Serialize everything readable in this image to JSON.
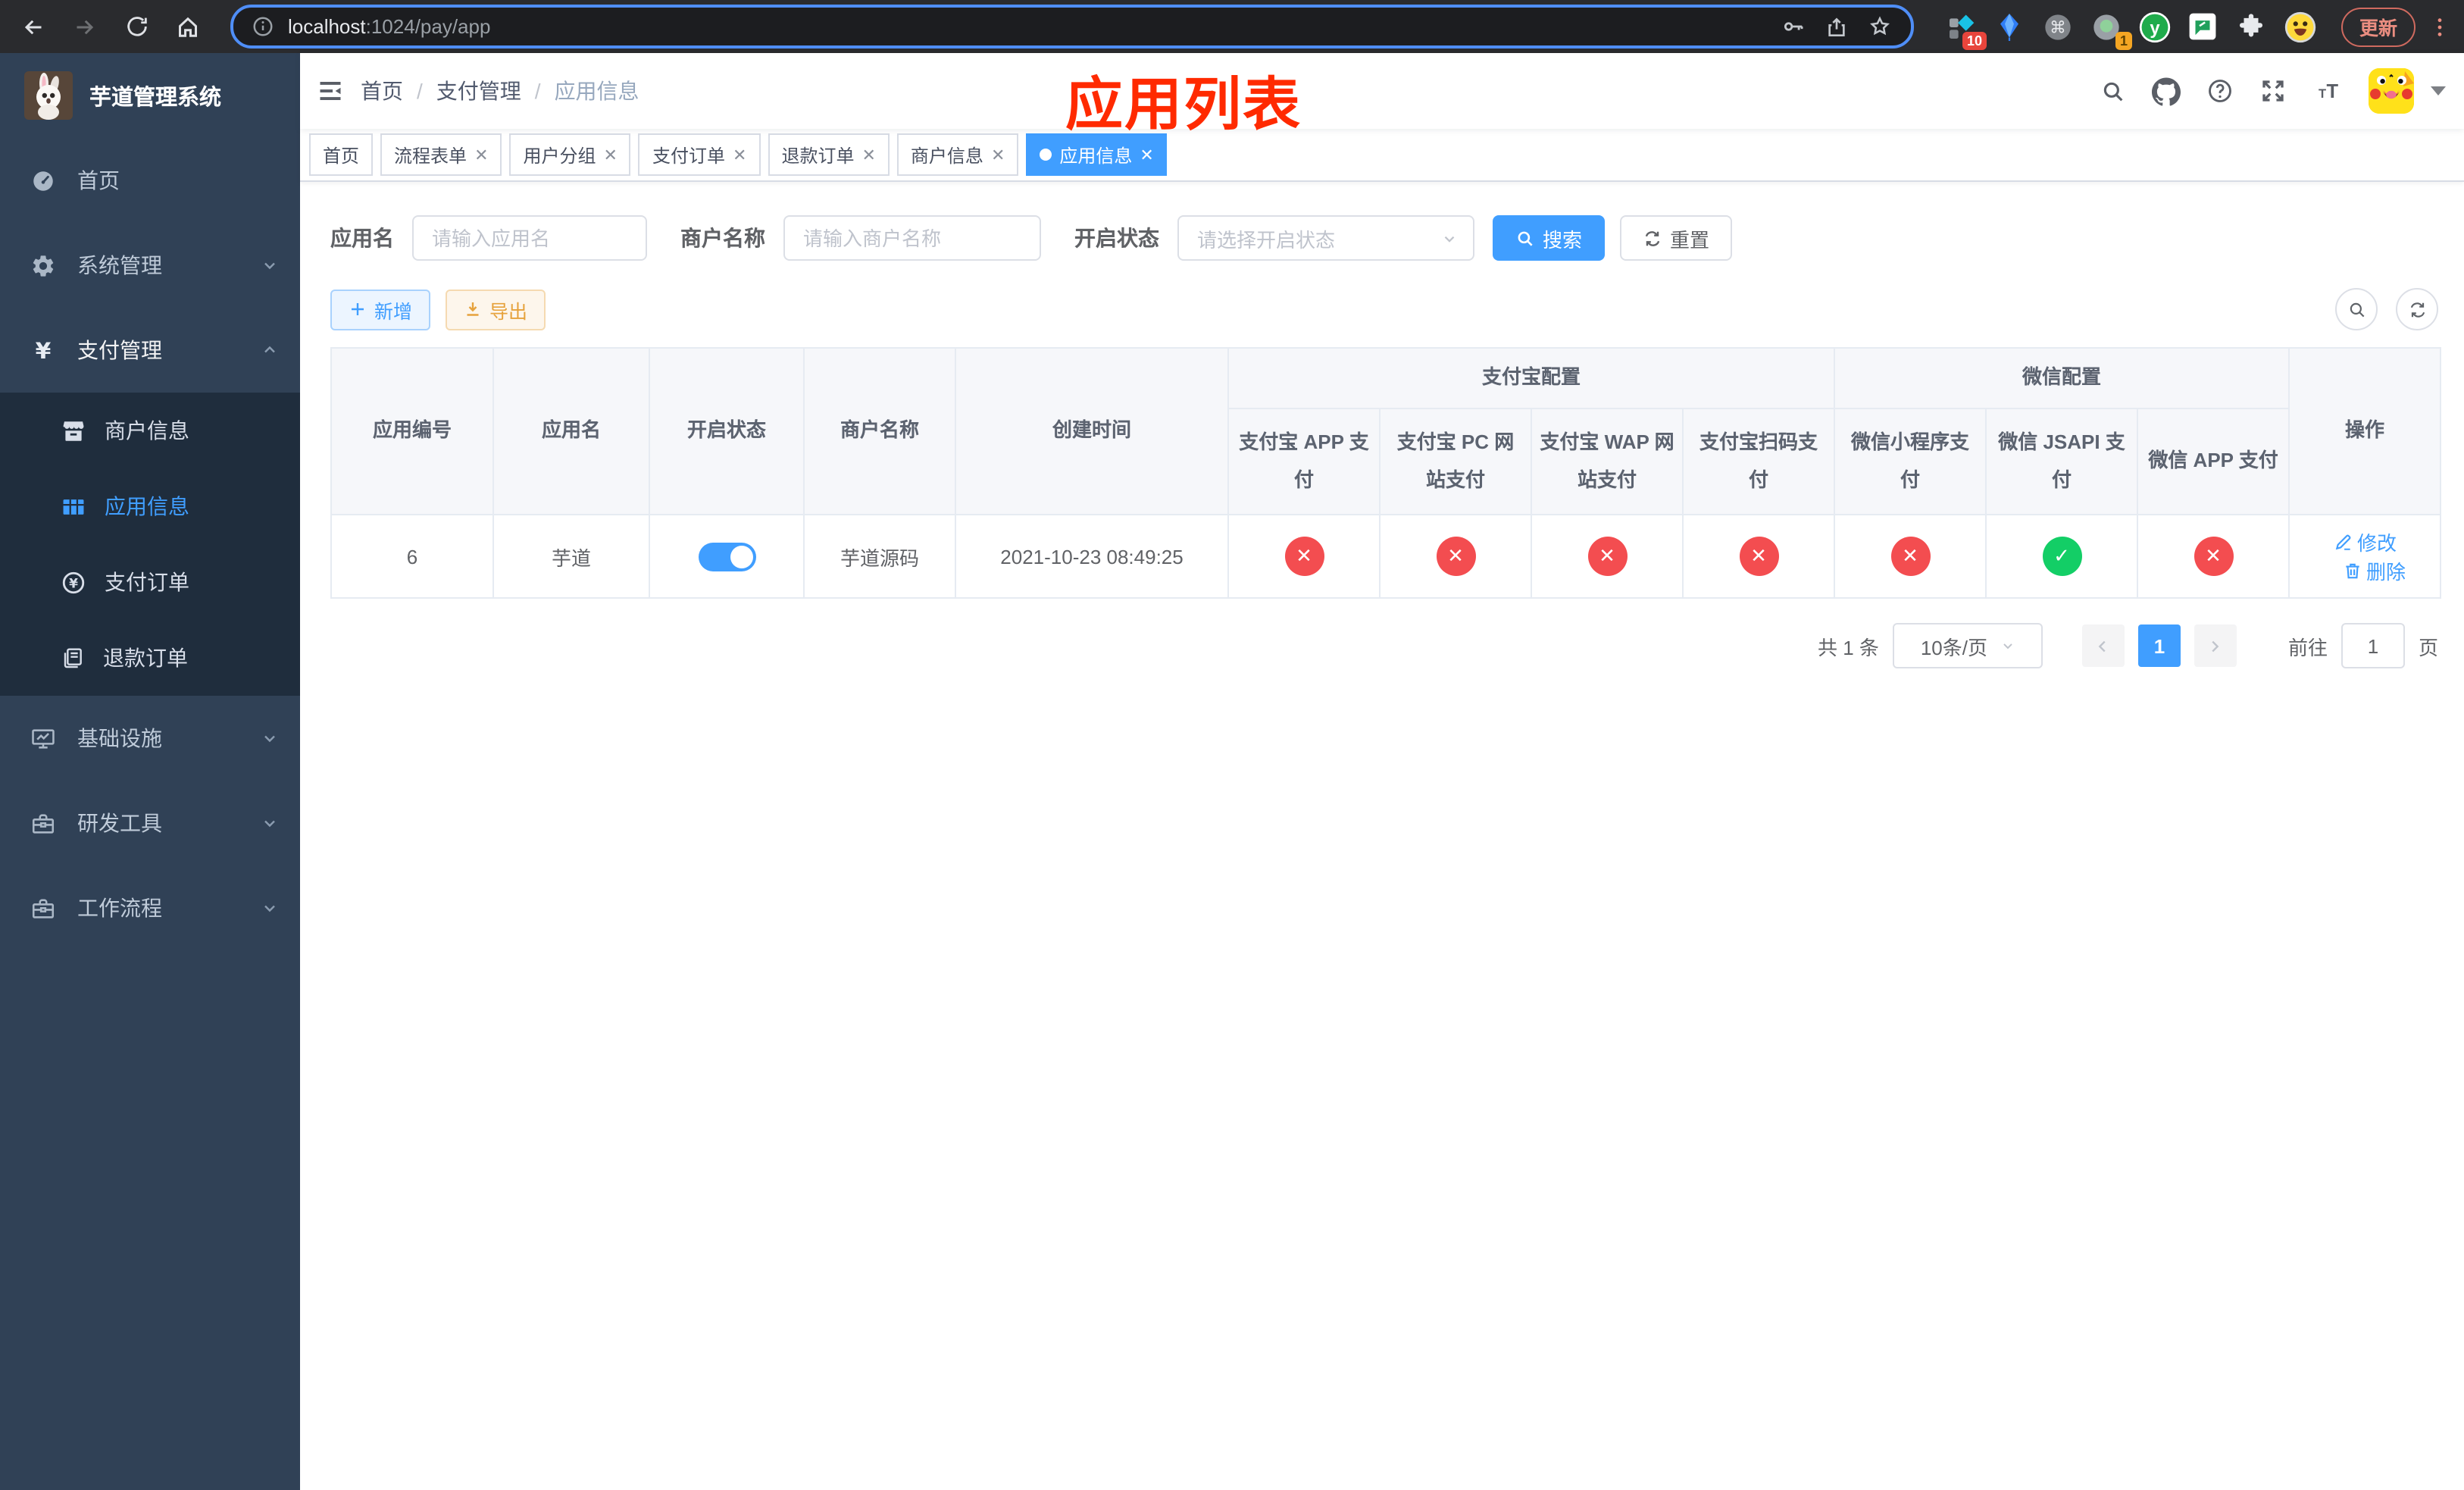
{
  "browser": {
    "url_host": "localhost",
    "url_path": ":1024/pay/app",
    "ext_badge_a": "10",
    "ext_badge_b": "1",
    "ext5_letter": "y",
    "update_label": "更新"
  },
  "annotation": {
    "text": "应用列表",
    "color": "#ff2a00"
  },
  "sidebar": {
    "title": "芋道管理系统",
    "menu": [
      {
        "label": "首页"
      },
      {
        "label": "系统管理"
      },
      {
        "label": "支付管理"
      },
      {
        "label": "商户信息"
      },
      {
        "label": "应用信息"
      },
      {
        "label": "支付订单"
      },
      {
        "label": "退款订单"
      },
      {
        "label": "基础设施"
      },
      {
        "label": "研发工具"
      },
      {
        "label": "工作流程"
      }
    ]
  },
  "breadcrumb": {
    "items": [
      "首页",
      "支付管理",
      "应用信息"
    ]
  },
  "tabs": [
    {
      "label": "首页",
      "closable": false,
      "active": false
    },
    {
      "label": "流程表单",
      "closable": true,
      "active": false
    },
    {
      "label": "用户分组",
      "closable": true,
      "active": false
    },
    {
      "label": "支付订单",
      "closable": true,
      "active": false
    },
    {
      "label": "退款订单",
      "closable": true,
      "active": false
    },
    {
      "label": "商户信息",
      "closable": true,
      "active": false
    },
    {
      "label": "应用信息",
      "closable": true,
      "active": true
    }
  ],
  "filters": {
    "app_name_label": "应用名",
    "app_name_placeholder": "请输入应用名",
    "merchant_label": "商户名称",
    "merchant_placeholder": "请输入商户名称",
    "status_label": "开启状态",
    "status_placeholder": "请选择开启状态",
    "search_label": "搜索",
    "reset_label": "重置"
  },
  "toolbar": {
    "add_label": "新增",
    "export_label": "导出"
  },
  "table": {
    "columns": {
      "app_id": "应用编号",
      "app_name": "应用名",
      "status": "开启状态",
      "merchant": "商户名称",
      "created": "创建时间",
      "alipay_group": "支付宝配置",
      "wechat_group": "微信配置",
      "ops": "操作",
      "channels": [
        "支付宝 APP 支付",
        "支付宝 PC 网站支付",
        "支付宝 WAP 网站支付",
        "支付宝扫码支付",
        "微信小程序支付",
        "微信 JSAPI 支付",
        "微信 APP 支付"
      ]
    },
    "row": {
      "id": "6",
      "name": "芋道",
      "enabled": true,
      "merchant": "芋道源码",
      "created": "2021-10-23 08:49:25",
      "channels": [
        "x",
        "x",
        "x",
        "x",
        "x",
        "check",
        "x"
      ],
      "edit_label": "修改",
      "delete_label": "删除"
    }
  },
  "pagination": {
    "total": "共 1 条",
    "page_size": "10条/页",
    "page": "1",
    "goto_label": "前往",
    "goto_value": "1",
    "page_unit": "页"
  },
  "colors": {
    "accent_blue": "#409eff",
    "sidebar_bg": "#304156",
    "submenu_bg": "#1f2d3d",
    "danger_red": "#f34d50",
    "success_green": "#13ce66",
    "warning_orange": "#e6a23c",
    "annotation_red": "#ff2a00"
  }
}
